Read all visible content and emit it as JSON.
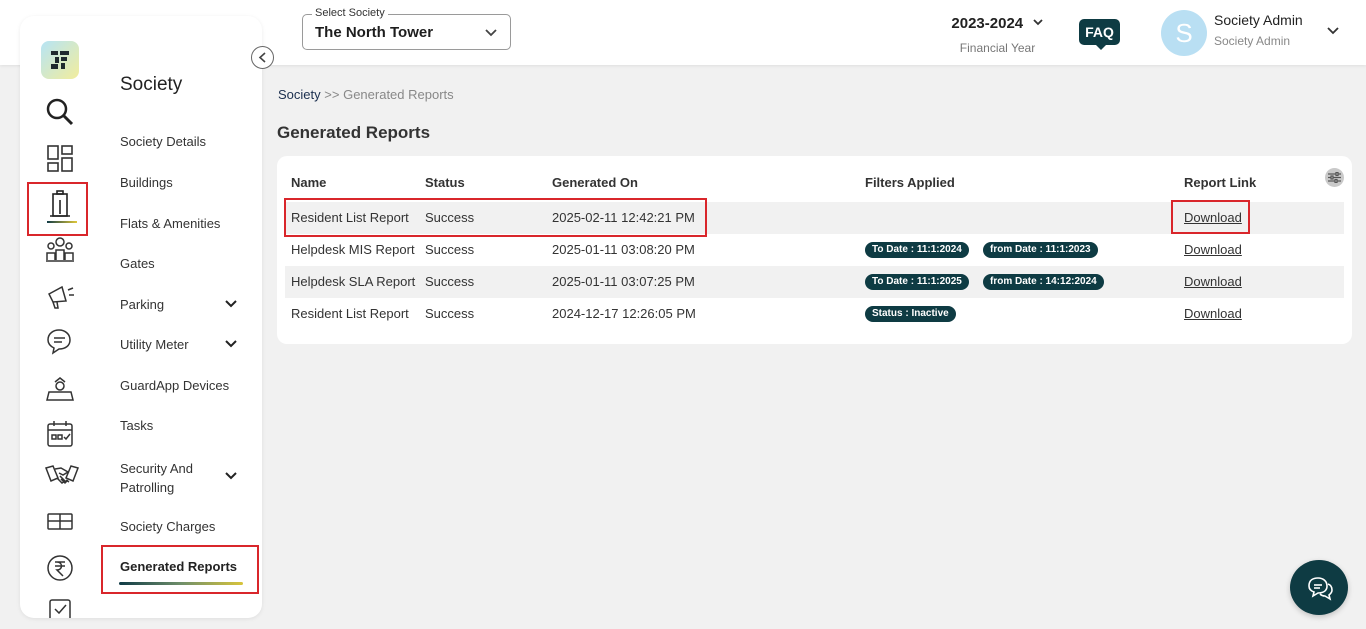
{
  "header": {
    "society_select_label": "Select Society",
    "society_value": "The North Tower",
    "financial_year": "2023-2024",
    "financial_year_label": "Financial Year",
    "faq_label": "FAQ",
    "avatar_initial": "S",
    "user_name": "Society Admin",
    "user_role": "Society Admin"
  },
  "sidebar": {
    "title": "Society",
    "rail_icons": [
      "search-icon",
      "dashboard-icon",
      "building-icon",
      "residents-icon",
      "announcement-icon",
      "helpdesk-icon",
      "guard-icon",
      "calendar-icon",
      "handshake-icon",
      "gift-icon",
      "rupee-icon",
      "checkbox-icon"
    ],
    "items": [
      {
        "label": "Society Details"
      },
      {
        "label": "Buildings"
      },
      {
        "label": "Flats & Amenities"
      },
      {
        "label": "Gates"
      },
      {
        "label": "Parking",
        "expandable": true
      },
      {
        "label": "Utility Meter",
        "expandable": true
      },
      {
        "label": "GuardApp Devices"
      },
      {
        "label": "Tasks"
      },
      {
        "label": "Security And Patrolling",
        "expandable": true
      },
      {
        "label": "Society Charges"
      },
      {
        "label": "Generated Reports",
        "active": true
      }
    ]
  },
  "breadcrumb": {
    "root": "Society",
    "separator": ">>",
    "current": "Generated Reports"
  },
  "page": {
    "title": "Generated Reports"
  },
  "table": {
    "columns": [
      "Name",
      "Status",
      "Generated On",
      "Filters Applied",
      "Report Link"
    ],
    "rows": [
      {
        "name": "Resident List Report",
        "status": "Success",
        "generated_on": "2025-02-11 12:42:21 PM",
        "filters": [],
        "link": "Download"
      },
      {
        "name": "Helpdesk MIS Report",
        "status": "Success",
        "generated_on": "2025-01-11 03:08:20 PM",
        "filters": [
          "To Date : 11:1:2024",
          "from Date : 11:1:2023"
        ],
        "link": "Download"
      },
      {
        "name": "Helpdesk SLA Report",
        "status": "Success",
        "generated_on": "2025-01-11 03:07:25 PM",
        "filters": [
          "To Date : 11:1:2025",
          "from Date : 14:12:2024"
        ],
        "link": "Download"
      },
      {
        "name": "Resident List Report",
        "status": "Success",
        "generated_on": "2024-12-17 12:26:05 PM",
        "filters": [
          "Status : Inactive"
        ],
        "link": "Download"
      }
    ]
  },
  "colors": {
    "brand_dark": "#0e3b43",
    "highlight": "#d9262b",
    "background": "#f1f1f1"
  }
}
